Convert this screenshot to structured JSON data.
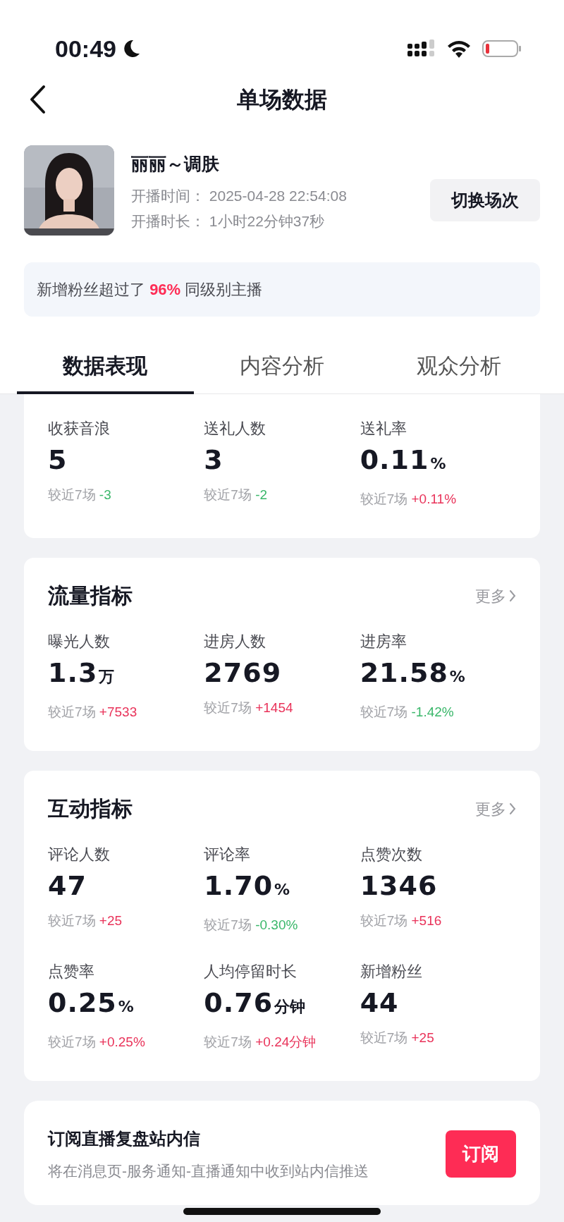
{
  "status_bar": {
    "time": "00:49"
  },
  "header": {
    "title": "单场数据"
  },
  "streamer": {
    "name": "丽丽～调肤",
    "start_label": "开播时间：",
    "start_value": "2025-04-28 22:54:08",
    "duration_label": "开播时长：",
    "duration_value": "1小时22分钟37秒",
    "switch_button": "切换场次"
  },
  "banner": {
    "prefix": "新增粉丝超过了 ",
    "highlight": "96%",
    "suffix": " 同级别主播"
  },
  "tabs": [
    {
      "label": "数据表现",
      "selected": true
    },
    {
      "label": "内容分析",
      "selected": false
    },
    {
      "label": "观众分析",
      "selected": false
    }
  ],
  "sections": [
    {
      "metrics": [
        {
          "label": "收获音浪",
          "value": "5",
          "compare_label": "较近7场",
          "delta": "-3",
          "color": "#3ab76a"
        },
        {
          "label": "送礼人数",
          "value": "3",
          "compare_label": "较近7场",
          "delta": "-2",
          "color": "#3ab76a"
        },
        {
          "label": "送礼率",
          "value": "0.11",
          "unit": "%",
          "compare_label": "较近7场",
          "delta": "+0.11%",
          "color": "#e9335a"
        }
      ]
    },
    {
      "title": "流量指标",
      "more": "更多",
      "metrics": [
        {
          "label": "曝光人数",
          "value": "1.3",
          "unit": "万",
          "compare_label": "较近7场",
          "delta": "+7533",
          "color": "#e9335a"
        },
        {
          "label": "进房人数",
          "value": "2769",
          "compare_label": "较近7场",
          "delta": "+1454",
          "color": "#e9335a"
        },
        {
          "label": "进房率",
          "value": "21.58",
          "unit": "%",
          "compare_label": "较近7场",
          "delta": "-1.42%",
          "color": "#3ab76a"
        }
      ]
    },
    {
      "title": "互动指标",
      "more": "更多",
      "metrics": [
        {
          "label": "评论人数",
          "value": "47",
          "compare_label": "较近7场",
          "delta": "+25",
          "color": "#e9335a"
        },
        {
          "label": "评论率",
          "value": "1.70",
          "unit": "%",
          "compare_label": "较近7场",
          "delta": "-0.30%",
          "color": "#3ab76a"
        },
        {
          "label": "点赞次数",
          "value": "1346",
          "compare_label": "较近7场",
          "delta": "+516",
          "color": "#e9335a"
        },
        {
          "label": "点赞率",
          "value": "0.25",
          "unit": "%",
          "compare_label": "较近7场",
          "delta": "+0.25%",
          "color": "#e9335a"
        },
        {
          "label": "人均停留时长",
          "value": "0.76",
          "unit": "分钟",
          "compare_label": "较近7场",
          "delta": "+0.24分钟",
          "color": "#e9335a"
        },
        {
          "label": "新增粉丝",
          "value": "44",
          "compare_label": "较近7场",
          "delta": "+25",
          "color": "#e9335a"
        }
      ]
    }
  ],
  "subscribe": {
    "title": "订阅直播复盘站内信",
    "description": "将在消息页-服务通知-直播通知中收到站内信推送",
    "button": "订阅"
  }
}
